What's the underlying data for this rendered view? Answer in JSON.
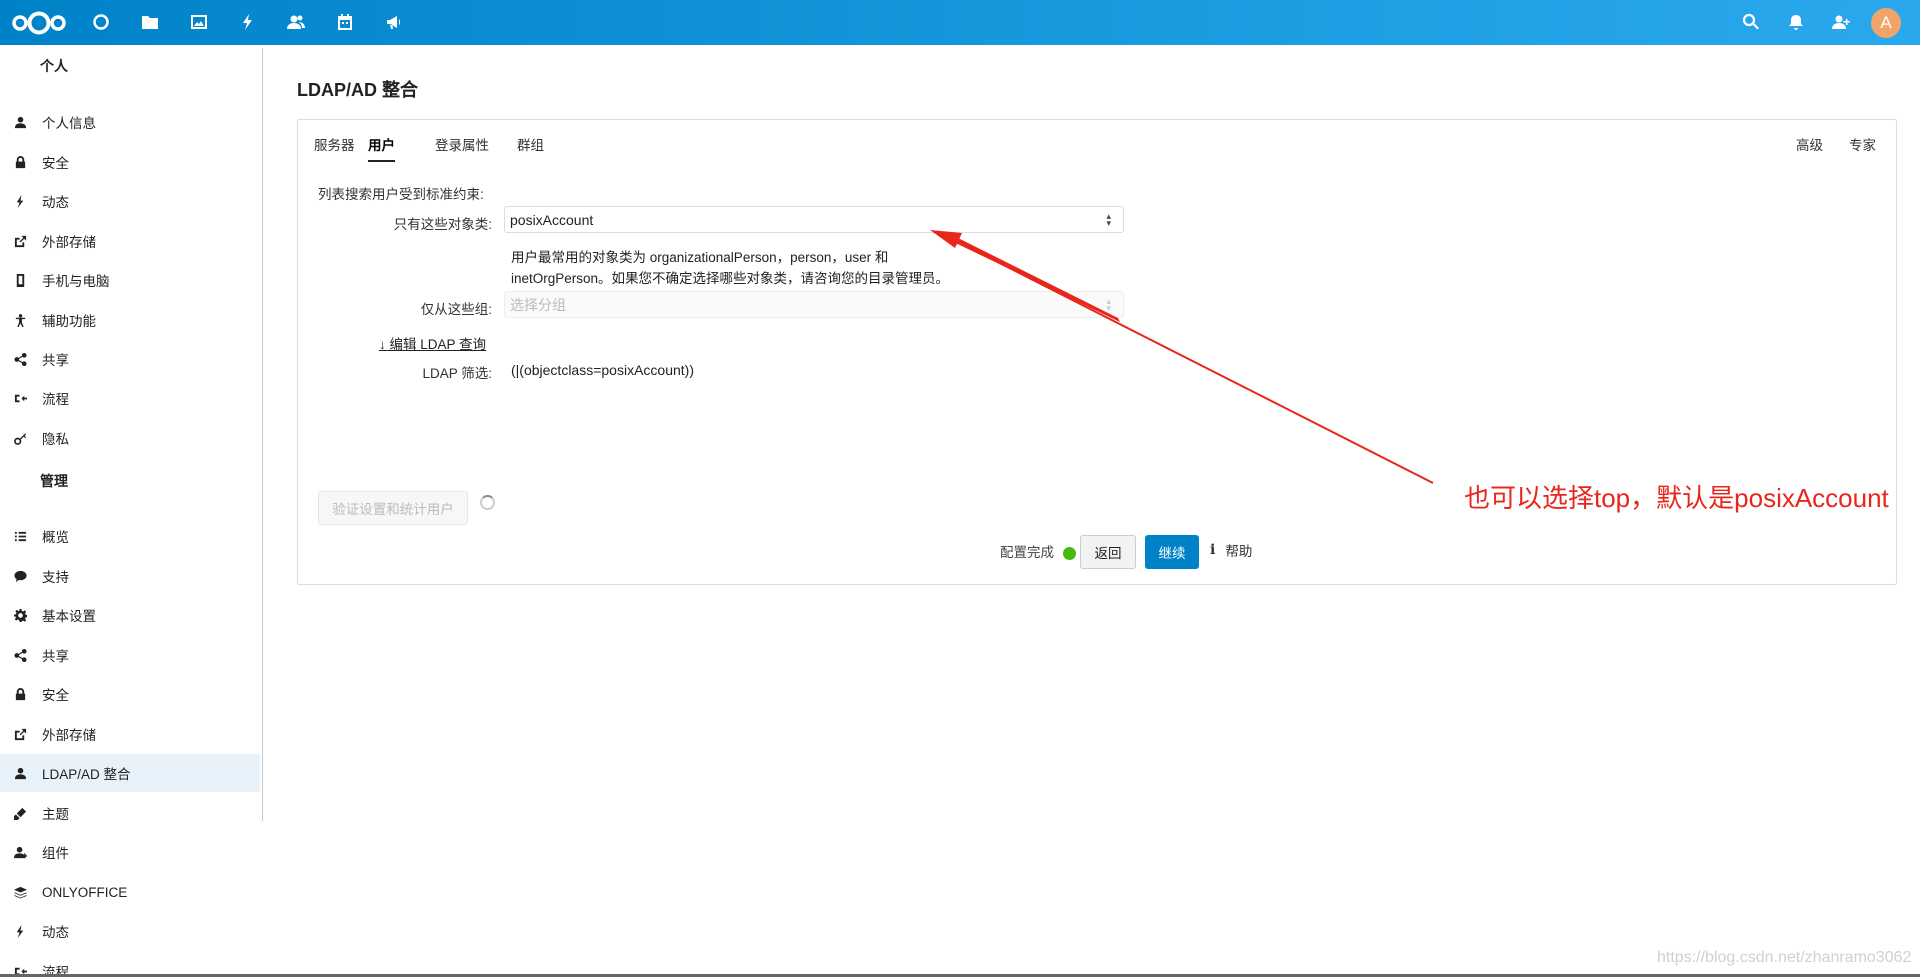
{
  "header": {
    "nav_icons": [
      "nextcloud-logo",
      "dashboard-icon",
      "files-icon",
      "photos-icon",
      "activity-icon",
      "contacts-icon",
      "calendar-icon",
      "announcements-icon"
    ],
    "right_icons": [
      "search-icon",
      "notifications-icon",
      "contacts-menu-icon"
    ],
    "avatar_letter": "A",
    "avatar_color": "#f0a46a",
    "bar_color": "#0082c9"
  },
  "sidebar": {
    "personal_title": "个人",
    "personal_items": [
      {
        "label": "个人信息",
        "icon": "user-icon"
      },
      {
        "label": "安全",
        "icon": "lock-icon"
      },
      {
        "label": "动态",
        "icon": "activity-icon"
      },
      {
        "label": "外部存储",
        "icon": "external-storage-icon"
      },
      {
        "label": "手机与电脑",
        "icon": "phone-icon"
      },
      {
        "label": "辅助功能",
        "icon": "accessibility-icon"
      },
      {
        "label": "共享",
        "icon": "share-icon"
      },
      {
        "label": "流程",
        "icon": "workflow-icon"
      },
      {
        "label": "隐私",
        "icon": "privacy-key-icon"
      }
    ],
    "admin_title": "管理",
    "admin_items": [
      {
        "label": "概览",
        "icon": "overview-list-icon"
      },
      {
        "label": "支持",
        "icon": "support-bubble-icon"
      },
      {
        "label": "基本设置",
        "icon": "gear-icon"
      },
      {
        "label": "共享",
        "icon": "share-icon"
      },
      {
        "label": "安全",
        "icon": "lock-icon"
      },
      {
        "label": "外部存储",
        "icon": "external-storage-icon"
      },
      {
        "label": "LDAP/AD 整合",
        "icon": "user-icon",
        "active": true
      },
      {
        "label": "主题",
        "icon": "theming-brush-icon"
      },
      {
        "label": "组件",
        "icon": "apps-user-icon"
      },
      {
        "label": "ONLYOFFICE",
        "icon": "onlyoffice-layers-icon"
      },
      {
        "label": "动态",
        "icon": "activity-icon"
      },
      {
        "label": "流程",
        "icon": "workflow-icon"
      }
    ]
  },
  "main": {
    "title": "LDAP/AD 整合",
    "tabs": [
      "服务器",
      "用户",
      "登录属性",
      "群组"
    ],
    "active_tab": "用户",
    "right_tabs": [
      "高级",
      "专家"
    ],
    "intro_label": "列表搜索用户受到标准约束:",
    "objectclass_label": "只有这些对象类:",
    "objectclass_value": "posixAccount",
    "hint_text": "用户最常用的对象类为 organizationalPerson，person，user 和 inetOrgPerson。如果您不确定选择哪些对象类，请咨询您的目录管理员。",
    "groups_label": "仅从这些组:",
    "groups_placeholder": "选择分组",
    "edit_query_link": "↓ 编辑 LDAP 查询",
    "filter_label": "LDAP 筛选:",
    "filter_value": "(|(objectclass=posixAccount))",
    "verify_button": "验证设置和统计用户",
    "status_text": "配置完成",
    "status_color": "#46ba0f",
    "back_button": "返回",
    "continue_button": "继续",
    "help_label": "帮助"
  },
  "annotation": {
    "text": "也可以选择top，默认是posixAccount",
    "color": "#e8261c"
  },
  "watermark": "https://blog.csdn.net/zhanramo3062"
}
